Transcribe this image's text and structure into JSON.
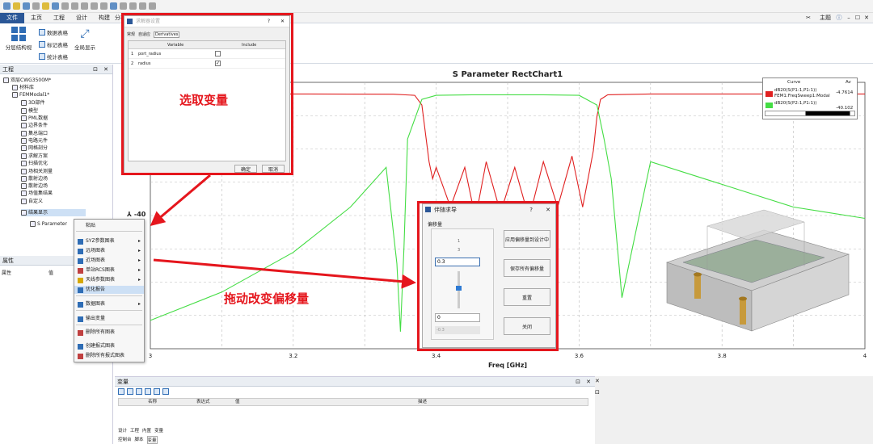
{
  "quick_toolbar": {
    "icons": [
      "new-file-icon",
      "open-icon",
      "save-icon",
      "saveas-icon",
      "folder-icon",
      "undo-icon",
      "redo-icon",
      "cut-icon",
      "copy-icon",
      "paste-icon",
      "delete-icon",
      "grid-icon",
      "print-icon",
      "link-icon",
      "refresh-icon",
      "edit-icon"
    ]
  },
  "menu": {
    "items": [
      "文件",
      "主页",
      "工程",
      "设计",
      "构建",
      "分析"
    ],
    "right_label": "主题",
    "right_icons": [
      "help-icon",
      "minimize-icon",
      "maximize-icon",
      "close-icon"
    ]
  },
  "ribbon": {
    "big1": "分层结构视",
    "small": [
      "数据表格",
      "标记表格",
      "统计表格"
    ],
    "big2": "全局显示"
  },
  "project_tree": {
    "title": "工程",
    "items": [
      {
        "label": "双层CWG3500M*",
        "level": 0
      },
      {
        "label": "材料库",
        "level": 1
      },
      {
        "label": "FEMModal1*",
        "level": 1
      },
      {
        "label": "3D部件",
        "level": 2
      },
      {
        "label": "模型",
        "level": 2
      },
      {
        "label": "PML数据",
        "level": 2
      },
      {
        "label": "边界条件",
        "level": 2
      },
      {
        "label": "集总端口",
        "level": 2
      },
      {
        "label": "电路元件",
        "level": 2
      },
      {
        "label": "网格剖分",
        "level": 2
      },
      {
        "label": "求解方案",
        "level": 2
      },
      {
        "label": "扫描优化",
        "level": 2
      },
      {
        "label": "场相关测量",
        "level": 2
      },
      {
        "label": "散射边场",
        "level": 2
      },
      {
        "label": "散射边场",
        "level": 2
      },
      {
        "label": "场值集结果",
        "level": 2
      },
      {
        "label": "自定义",
        "level": 2
      },
      {
        "label": "结果显示",
        "level": 2
      },
      {
        "label": "S Parameter",
        "level": 3
      }
    ]
  },
  "properties": {
    "title": "属性",
    "col1": "属性",
    "col2": "值"
  },
  "chart": {
    "y_hint": "-40"
  },
  "chart_data": {
    "type": "line",
    "title": "S Parameter RectChart1",
    "xlabel": "Freq [GHz]",
    "xlim": [
      3.0,
      4.0
    ],
    "ylim": [
      -45,
      2
    ],
    "xticks": [
      "3",
      "3.2",
      "3.4",
      "3.6",
      "3.8",
      "4"
    ],
    "series": [
      {
        "name": "dB20(S(P1:1,P1:1)) FEM1:FreqSweep1:Modal",
        "color": "#e02020",
        "x": [
          3.0,
          3.22,
          3.34,
          3.37,
          3.38,
          3.39,
          3.395,
          3.4,
          3.42,
          3.44,
          3.455,
          3.47,
          3.49,
          3.51,
          3.53,
          3.55,
          3.57,
          3.59,
          3.605,
          3.62,
          3.625,
          3.63,
          3.64,
          3.7,
          4.0
        ],
        "y": [
          -0.05,
          -0.05,
          -0.1,
          -0.3,
          -2,
          -12,
          -15,
          -13,
          -20,
          -13,
          -22,
          -12,
          -21,
          -13,
          -22,
          -12,
          -20,
          -11,
          -20,
          -10,
          -4,
          -1,
          -0.2,
          -0.05,
          -0.05
        ]
      },
      {
        "name": "dB20(S(P2:1,P1:1))",
        "color": "#44dd44",
        "x": [
          3.0,
          3.1,
          3.2,
          3.28,
          3.33,
          3.345,
          3.35,
          3.355,
          3.36,
          3.38,
          3.4,
          3.45,
          3.5,
          3.55,
          3.6,
          3.625,
          3.635,
          3.645,
          3.66,
          3.68,
          3.7,
          3.8,
          3.9,
          4.0
        ],
        "y": [
          -40,
          -35,
          -28,
          -20,
          -13,
          -30,
          -42,
          -27,
          -8,
          -1,
          -0.3,
          -0.2,
          -0.2,
          -0.2,
          -0.3,
          -2,
          -8,
          -15,
          -36,
          -24,
          -12,
          -16,
          -20,
          -22
        ]
      }
    ],
    "legend_position": "top-right",
    "grid": true
  },
  "legend": {
    "header": "Curve",
    "header2": "Av",
    "entry1_a": "dB20(S(P1:1,P1:1))",
    "entry1_b": "FEM1:FreqSweep1:Modal",
    "entry1_val": "-4.7614",
    "entry2_a": "dB20(S(P2:1,P1:1))",
    "entry2_val": "-40.102"
  },
  "dialog_solver": {
    "title": "求解器设置",
    "tabs": [
      "常规",
      "自适应",
      "Derivatives"
    ],
    "col_variable": "Variable",
    "col_include": "Include",
    "rows": [
      {
        "idx": "1",
        "name": "port_radius",
        "checked": false
      },
      {
        "idx": "2",
        "name": "radius",
        "checked": true
      }
    ],
    "ok": "确定",
    "cancel": "取消",
    "help": "?",
    "close": "✕"
  },
  "context_menu": {
    "items": [
      "粘贴",
      "SYZ参数图表",
      "远场图表",
      "近场图表",
      "单站RCS图表",
      "天线参数图表",
      "优化报告",
      "数据图表",
      "输出变量",
      "删除所有图表",
      "创建报式图表",
      "删除所有报式图表"
    ]
  },
  "dialog_tuning": {
    "title": "伴随求导",
    "help": "?",
    "close": "✕",
    "group_label": "偏移量",
    "scale_top": "1",
    "scale_mid": "3",
    "input_value": "0.3",
    "min_value": "0",
    "low_value": "-0.3",
    "btn_apply": "应用偏移量到设计中",
    "btn_save": "保存所有偏移量",
    "btn_reset": "重置",
    "btn_close": "关闭"
  },
  "variables_panel": {
    "title": "变量",
    "cols": [
      "名称",
      "表达式",
      "值",
      "描述"
    ],
    "tabs": [
      "设计",
      "工程",
      "内置",
      "变量"
    ],
    "bottom_tabs": [
      "控制台",
      "脚本",
      "变量"
    ]
  },
  "annotations": {
    "select_var": "选取变量",
    "drag_offset": "拖动改变偏移量"
  },
  "colors": {
    "accent": "#2b5797",
    "annotation": "#e5161d",
    "s11": "#e02020",
    "s21": "#44dd44"
  }
}
